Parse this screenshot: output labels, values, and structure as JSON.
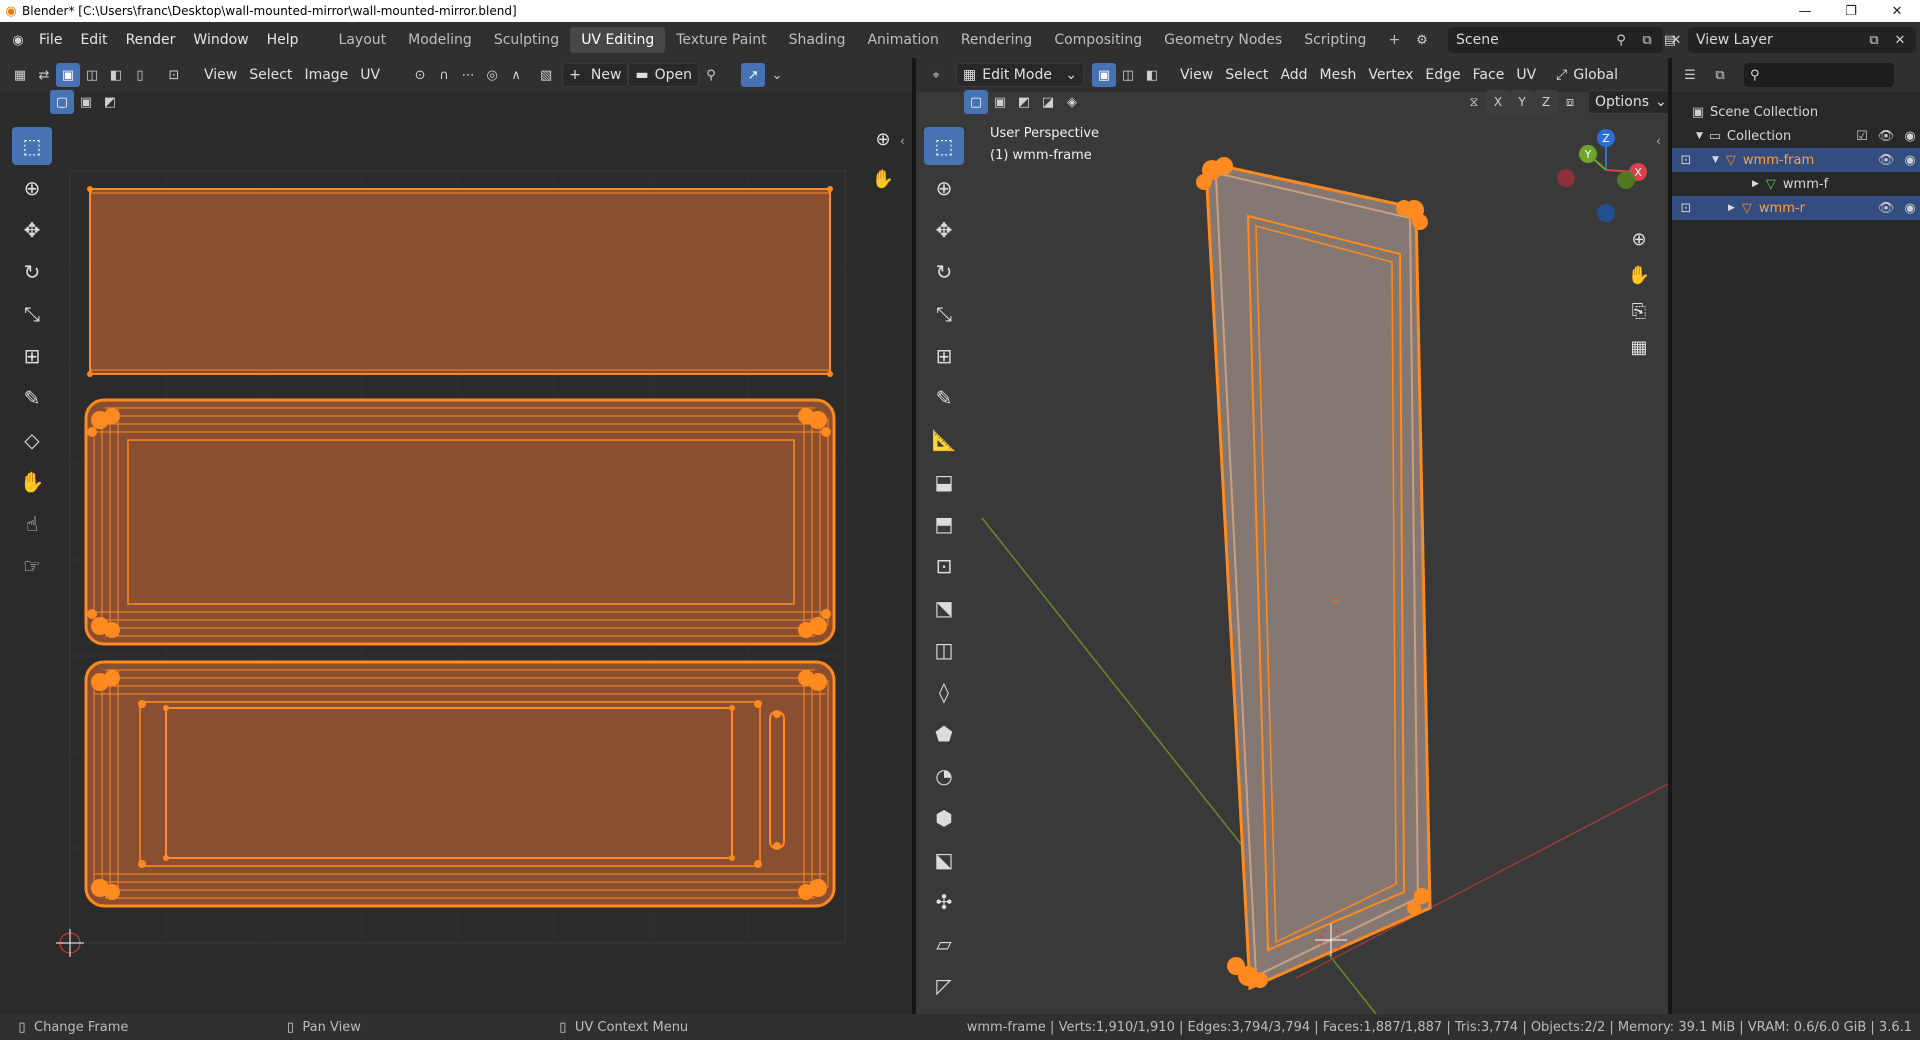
{
  "window": {
    "title": "Blender* [C:\\Users\\franc\\Desktop\\wall-mounted-mirror\\wall-mounted-mirror.blend]",
    "minimize": "—",
    "restore": "❐",
    "close": "✕"
  },
  "menu": [
    "File",
    "Edit",
    "Render",
    "Window",
    "Help"
  ],
  "workspaces": [
    "Layout",
    "Modeling",
    "Sculpting",
    "UV Editing",
    "Texture Paint",
    "Shading",
    "Animation",
    "Rendering",
    "Compositing",
    "Geometry Nodes",
    "Scripting"
  ],
  "active_workspace": "UV Editing",
  "add_workspace": "+",
  "scene": "Scene",
  "view_layer": "View Layer",
  "uv_editor": {
    "menus": [
      "View",
      "Select",
      "Image",
      "UV"
    ],
    "new_label": "New",
    "open_label": "Open"
  },
  "viewport": {
    "mode": "Edit Mode",
    "menus": [
      "View",
      "Select",
      "Add",
      "Mesh",
      "Vertex",
      "Edge",
      "Face",
      "UV"
    ],
    "orientation": "Global",
    "options": "Options",
    "axis": [
      "X",
      "Y",
      "Z"
    ],
    "overlay_title": "User Perspective",
    "overlay_object": "(1) wmm-frame",
    "gizmo": {
      "x": "X",
      "y": "Y",
      "z": "Z"
    }
  },
  "outliner": {
    "scene_collection": "Scene Collection",
    "collection": "Collection",
    "items": [
      {
        "label": "wmm-fram",
        "selected": true
      },
      {
        "label": "wmm-f",
        "selected": false
      },
      {
        "label": "wmm-r",
        "selected": true
      }
    ]
  },
  "status": {
    "hint1": "Change Frame",
    "hint2": "Pan View",
    "hint3": "UV Context Menu",
    "stats": "wmm-frame | Verts:1,910/1,910 | Edges:3,794/3,794 | Faces:1,887/1,887 | Tris:3,774 | Objects:2/2 | Memory: 39.1 MiB | VRAM: 0.6/6.0 GiB | 3.6.1"
  },
  "colors": {
    "accent": "#4772b3",
    "selection": "#ff8a1f",
    "uv_fill": "#8a4f31",
    "mesh_fill": "#857873"
  }
}
